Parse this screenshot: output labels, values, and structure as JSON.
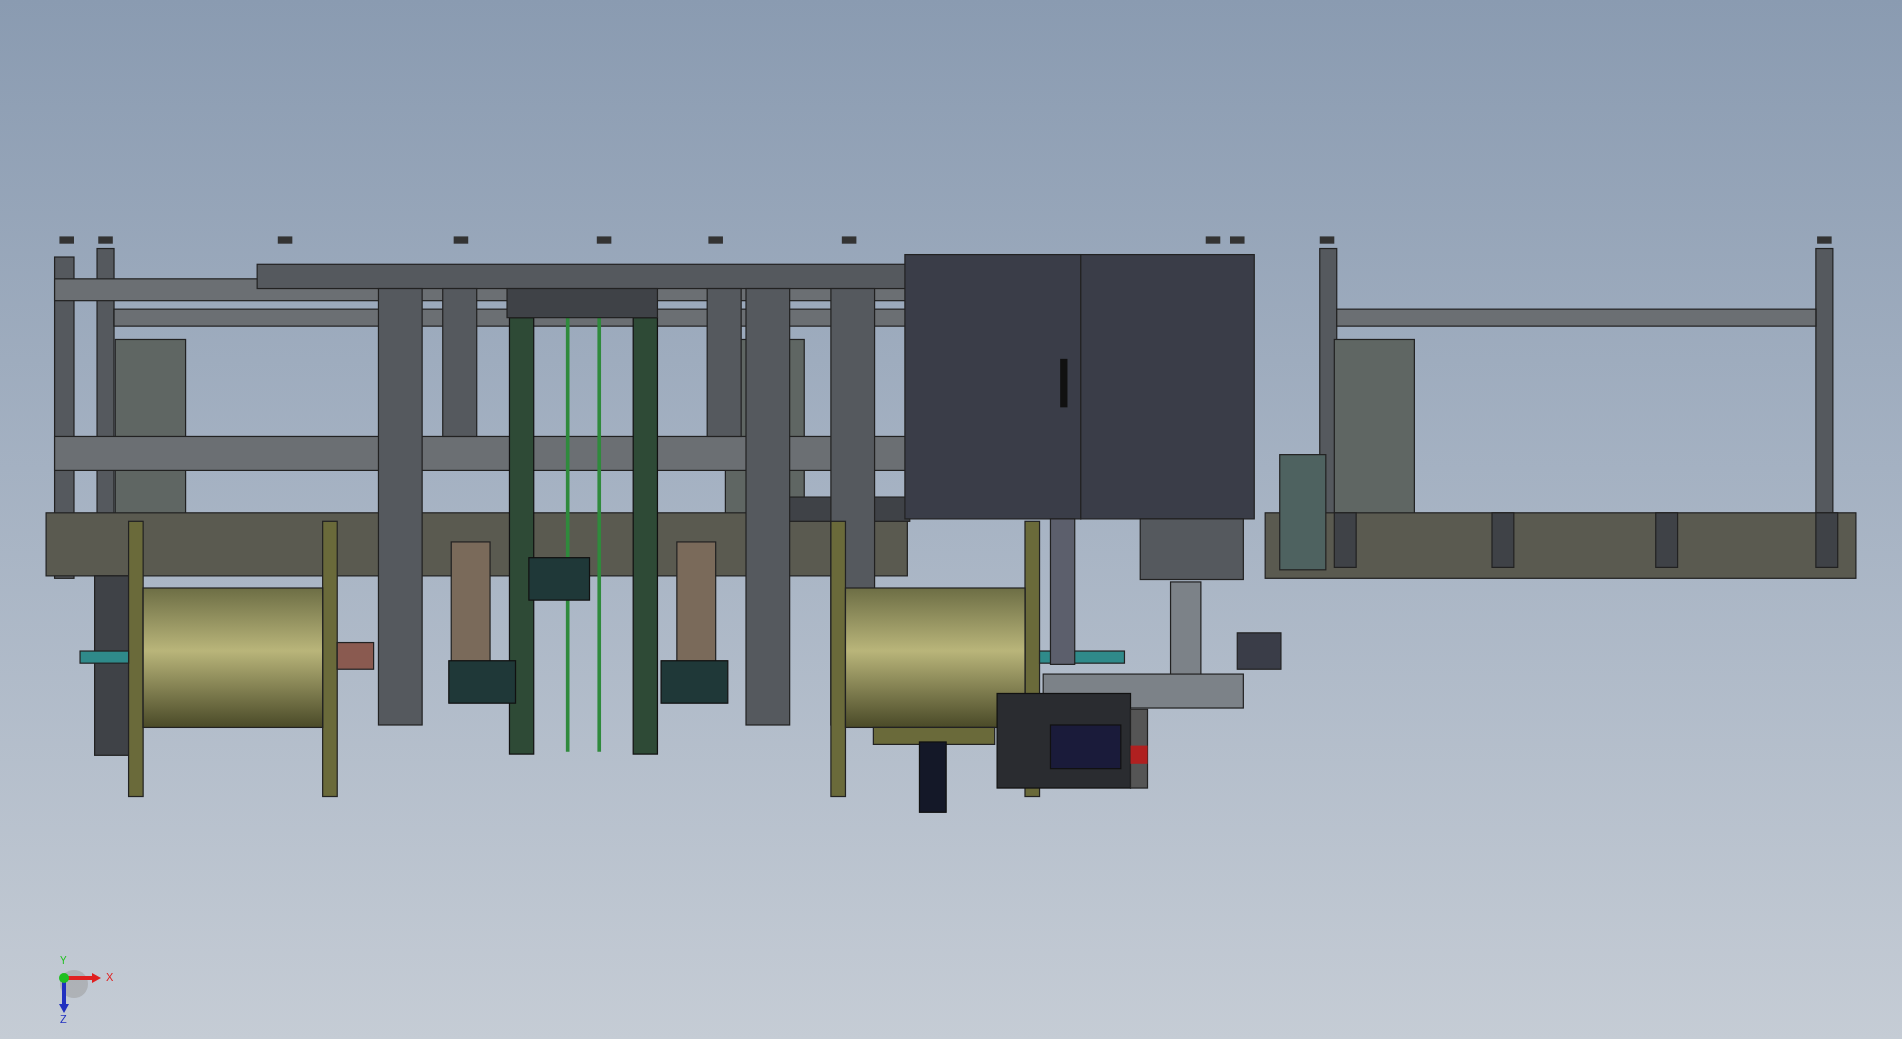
{
  "view_triad": {
    "axes": [
      {
        "label": "Y",
        "color": "#20c020"
      },
      {
        "label": "X",
        "color": "#e02020"
      },
      {
        "label": "Z",
        "color": "#2030c0"
      }
    ]
  }
}
